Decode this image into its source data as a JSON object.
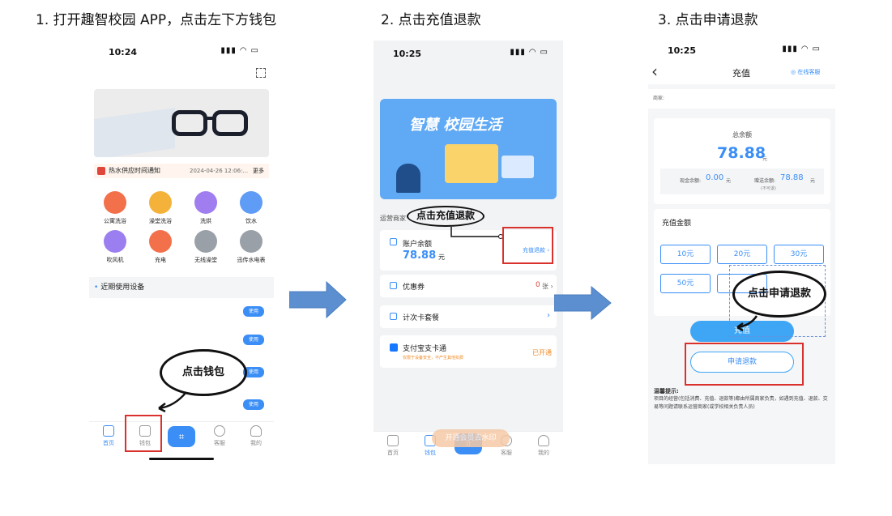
{
  "steps": [
    {
      "title": "1. 打开趣智校园 APP，点击左下方钱包"
    },
    {
      "title": "2.     点击充值退款"
    },
    {
      "title": "3.    点击申请退款"
    }
  ],
  "phone1": {
    "time": "10:24",
    "notice_icon": "speaker-icon",
    "notice_text": "热水供应时间通知",
    "notice_date": "2024-04-26 12:06:...",
    "notice_more": "更多",
    "services": [
      {
        "label": "公寓洗浴",
        "color": "#f2714b"
      },
      {
        "label": "澡堂洗浴",
        "color": "#f5b23a"
      },
      {
        "label": "洗烘",
        "color": "#a07ef0"
      },
      {
        "label": "饮水",
        "color": "#5f9cf5"
      },
      {
        "label": "吹风机",
        "color": "#9b7ff0"
      },
      {
        "label": "充电",
        "color": "#f2714b"
      },
      {
        "label": "无线澡堂",
        "color": "#9aa0a8"
      },
      {
        "label": "迅传水电表",
        "color": "#9aa0a8"
      }
    ],
    "recent_title": "近期使用设备",
    "use_label": "使用",
    "tabs": [
      {
        "label": "首页",
        "icon": "home-icon"
      },
      {
        "label": "钱包",
        "icon": "wallet-icon"
      },
      {
        "label": "",
        "icon": "scan-icon"
      },
      {
        "label": "客服",
        "icon": "chat-icon"
      },
      {
        "label": "我的",
        "icon": "user-icon"
      }
    ],
    "bubble_text": "点击钱包"
  },
  "phone2": {
    "time": "10:25",
    "banner_text": "智慧 校园生活",
    "operator_label": "运营商家",
    "balance_label": "账户余额",
    "balance_value": "78.88",
    "balance_unit": "元",
    "recharge_refund": "充值退款 ›",
    "coupon_label": "优惠券",
    "coupon_count": "0",
    "coupon_unit": "张 ›",
    "package_label": "计次卡套餐",
    "package_arrow": "›",
    "alipay_label": "支付宝支卡通",
    "alipay_sub": "仅限于设备安全，不产生其他扣费",
    "alipay_status": "已开通",
    "watermark": "开通会员去水印",
    "tabs": [
      {
        "label": "首页",
        "icon": "home-icon"
      },
      {
        "label": "钱包",
        "icon": "wallet-icon"
      },
      {
        "label": "",
        "icon": "scan-icon"
      },
      {
        "label": "客服",
        "icon": "chat-icon"
      },
      {
        "label": "我的",
        "icon": "user-icon"
      }
    ],
    "bubble_text": "点击充值退款"
  },
  "phone3": {
    "time": "10:25",
    "back": "‹",
    "title": "充值",
    "online_service": "在线客服",
    "merchant_label": "商家:",
    "total_label": "总余额",
    "total_value": "78.88",
    "total_unit": "元",
    "cash_label": "现金余额:",
    "cash_value": "0.00",
    "cash_unit": "元",
    "gift_label": "赠送余额:",
    "gift_value": "78.88",
    "gift_unit": "元",
    "gift_note": "(不可退)",
    "amount_title": "充值金额",
    "amounts": [
      "10元",
      "20元",
      "30元",
      "50元",
      ""
    ],
    "recharge_btn": "充值",
    "refund_btn": "申请退款",
    "tips_title": "温馨提示:",
    "tips_text": "项目的经营(包括消费、充值、退款等)都由所属商家负责，如遇到充值、退款、交易等问题请联系运营商家(或学校相关负责人员)",
    "bubble_text": "点击申请退款"
  },
  "colors": {
    "accent": "#3a8ef6",
    "highlight": "#d9312b",
    "orange": "#f08a24",
    "arrow": "#5b8fd0"
  }
}
